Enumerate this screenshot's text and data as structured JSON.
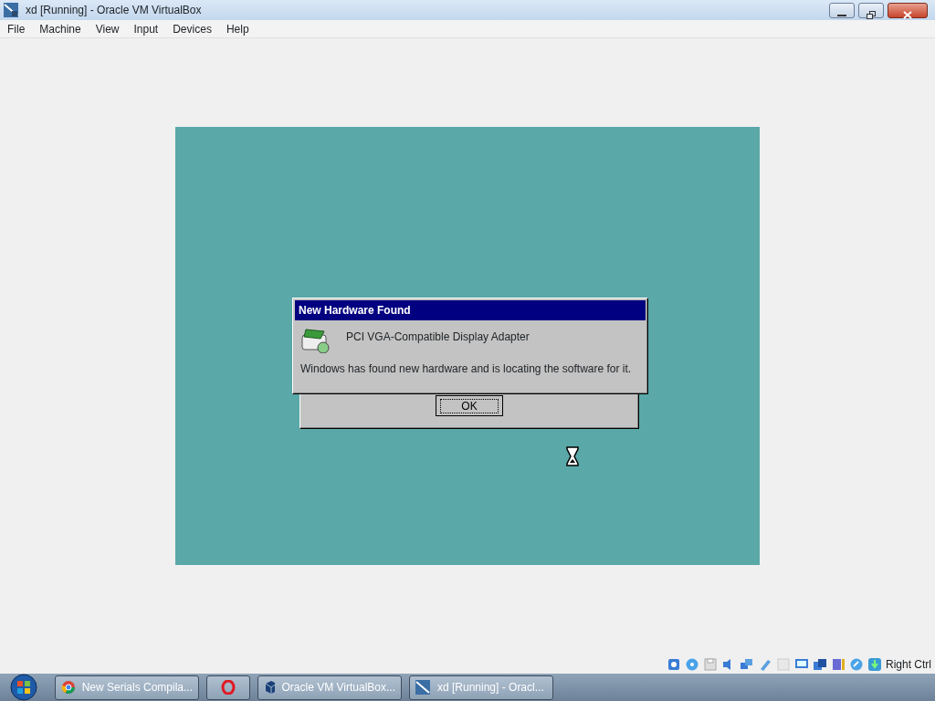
{
  "window": {
    "title": "xd [Running] - Oracle VM VirtualBox"
  },
  "menu": [
    "File",
    "Machine",
    "View",
    "Input",
    "Devices",
    "Help"
  ],
  "guest": {
    "dialog": {
      "title": "New Hardware Found",
      "device": "PCI VGA-Compatible Display Adapter",
      "message": "Windows has found new hardware and is locating the software for it."
    },
    "back_button": "OK"
  },
  "status_bar": {
    "host_key": "Right Ctrl"
  },
  "taskbar": [
    {
      "label": "New Serials Compila..."
    },
    {
      "kind": "icon-only"
    },
    {
      "label": "Oracle VM VirtualBox..."
    },
    {
      "label": "xd [Running] - Oracl..."
    }
  ]
}
